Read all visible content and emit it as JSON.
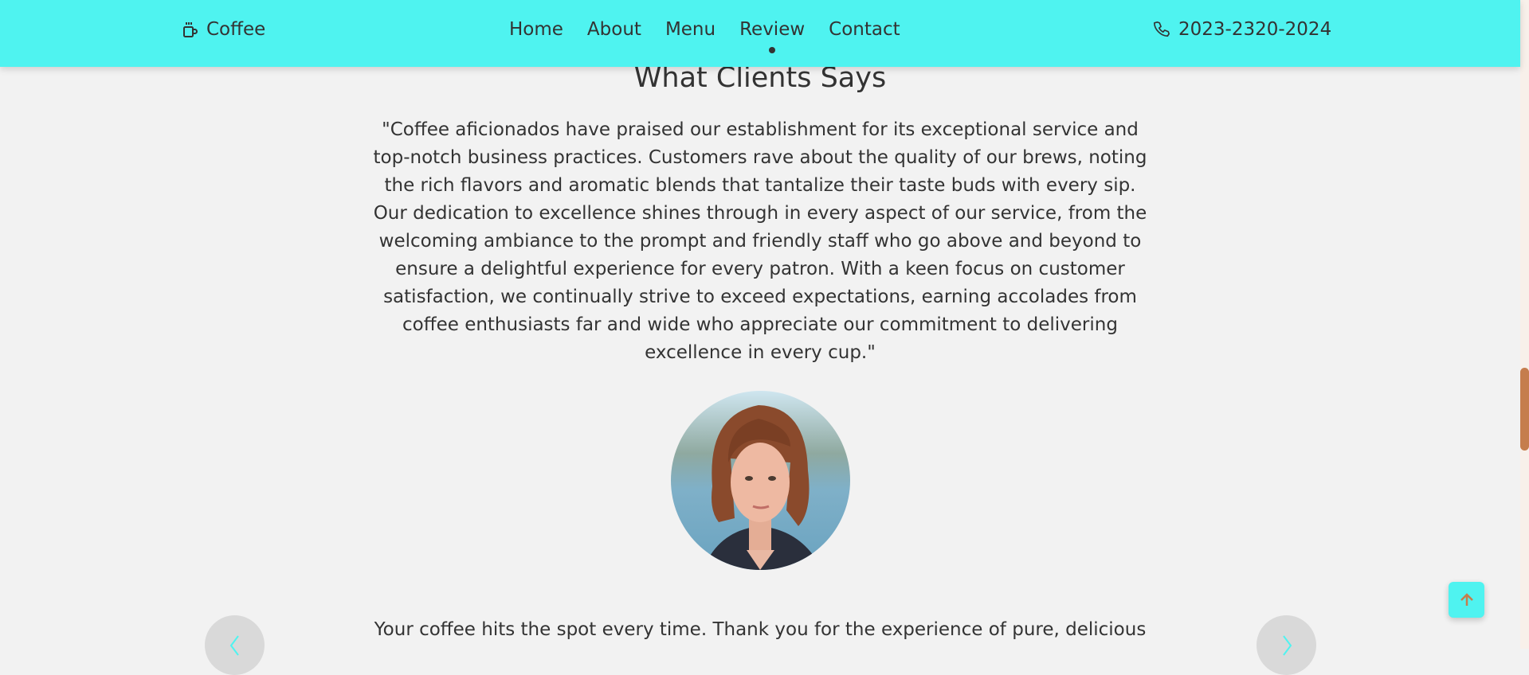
{
  "colors": {
    "accent": "#4ff3f0",
    "scroll_thumb": "#c57d4d",
    "up_arrow": "#c57d4d",
    "background": "#f2f2f2"
  },
  "header": {
    "logo": {
      "icon": "coffee-cup-icon",
      "label": "Coffee"
    },
    "nav": [
      {
        "label": "Home"
      },
      {
        "label": "About"
      },
      {
        "label": "Menu"
      },
      {
        "label": "Review",
        "active": true
      },
      {
        "label": "Contact"
      }
    ],
    "phone": {
      "icon": "phone-icon",
      "number": "2023-2320-2024"
    }
  },
  "testimonials": {
    "title": "What Clients Says",
    "quote": "\"Coffee aficionados have praised our establishment for its exceptional service and top-notch business practices. Customers rave about the quality of our brews, noting the rich flavors and aromatic blends that tantalize their taste buds with every sip. Our dedication to excellence shines through in every aspect of our service, from the welcoming ambiance to the prompt and friendly staff who go above and beyond to ensure a delightful experience for every patron. With a keen focus on customer satisfaction, we continually strive to exceed expectations, earning accolades from coffee enthusiasts far and wide who appreciate our commitment to delivering excellence in every cup.\"",
    "review_text": "Your coffee hits the spot every time. Thank you for the experience of pure, delicious",
    "prev_icon": "chevron-left-icon",
    "next_icon": "chevron-right-icon"
  },
  "back_to_top": {
    "icon": "arrow-up-icon"
  }
}
